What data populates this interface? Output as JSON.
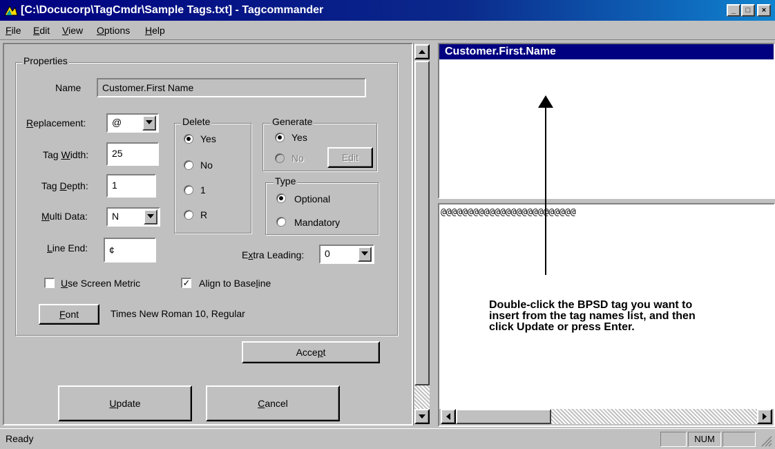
{
  "window": {
    "title": "[C:\\Docucorp\\TagCmdr\\Sample Tags.txt] - Tagcommander",
    "minimize": "_",
    "maximize": "□",
    "close": "×"
  },
  "menu": [
    "File",
    "Edit",
    "View",
    "Options",
    "Help"
  ],
  "properties": {
    "group_label": "Properties",
    "name_label": "Name",
    "name_value": "Customer.First Name",
    "replacement_label": "Replacement:",
    "replacement_value": "@",
    "tag_width_label": "Tag Width:",
    "tag_width_value": "25",
    "tag_depth_label": "Tag Depth:",
    "tag_depth_value": "1",
    "multi_data_label": "Multi Data:",
    "multi_data_value": "N",
    "line_end_label": "Line End:",
    "line_end_value": "¢",
    "extra_leading_label": "Extra Leading:",
    "extra_leading_value": "0",
    "delete": {
      "label": "Delete",
      "options": [
        "Yes",
        "No",
        "1",
        "R"
      ],
      "selected": "Yes"
    },
    "generate": {
      "label": "Generate",
      "yes": "Yes",
      "no": "No",
      "edit_button": "Edit"
    },
    "type": {
      "label": "Type",
      "optional": "Optional",
      "mandatory": "Mandatory"
    },
    "use_screen_metric": "Use Screen Metric",
    "use_screen_metric_checked": false,
    "align_to_baseline": "Align to Baseline",
    "align_to_baseline_checked": true,
    "font_button": "Font",
    "font_value": "Times New Roman 10, Regular"
  },
  "buttons": {
    "accept": "Accept",
    "update": "Update",
    "cancel": "Cancel"
  },
  "tag_names": {
    "selected": "Customer.First.Name"
  },
  "preview": {
    "tag_string": "@@@@@@@@@@@@@@@@@@@@@@@@@"
  },
  "callout": "Double-click the BPSD tag you want to insert from the tag names list, and then click Update or press Enter.",
  "status": {
    "text": "Ready",
    "num": "NUM"
  }
}
